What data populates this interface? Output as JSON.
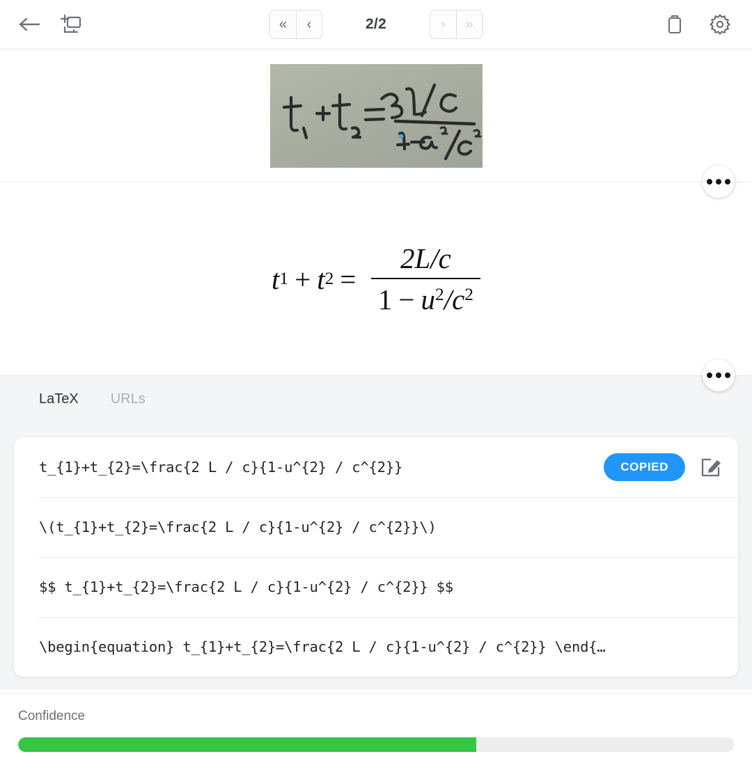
{
  "toolbar": {
    "back_icon": "back-arrow-icon",
    "snip_icon": "new-snip-screen-icon",
    "first_label": "«",
    "prev_label": "‹",
    "next_label": "›",
    "last_label": "»",
    "page_indicator": "2/2",
    "delete_icon": "trash-icon",
    "settings_icon": "gear-icon"
  },
  "source_image": {
    "alt": "handwritten equation photo",
    "handwriting": "t₁ + t₂ = 2L/c over 1 - u²/c²"
  },
  "rendered_equation": {
    "lhs_t": "t",
    "sub1": "1",
    "plus": "+",
    "sub2": "2",
    "equals": "=",
    "numerator": "2L/c",
    "den_one": "1",
    "den_minus": "−",
    "den_u": "u",
    "den_sup1": "2",
    "den_slash": "/",
    "den_c": "c",
    "den_sup2": "2"
  },
  "overflow_buttons": {
    "image_menu_label": "•••",
    "render_menu_label": "•••"
  },
  "tabs": [
    {
      "label": "LaTeX",
      "active": true
    },
    {
      "label": "URLs",
      "active": false
    }
  ],
  "latex_rows": [
    {
      "code": "t_{1}+t_{2}=\\frac{2 L / c}{1-u^{2} / c^{2}}",
      "copied_label": "COPIED",
      "edit_icon": "edit-square-icon"
    },
    {
      "code": "\\(t_{1}+t_{2}=\\frac{2 L / c}{1-u^{2} / c^{2}}\\)"
    },
    {
      "code": "$$ t_{1}+t_{2}=\\frac{2 L / c}{1-u^{2} / c^{2}} $$"
    },
    {
      "code": "\\begin{equation} t_{1}+t_{2}=\\frac{2 L / c}{1-u^{2} / c^{2}} \\end{…"
    }
  ],
  "confidence": {
    "label": "Confidence",
    "percent": 64
  },
  "colors": {
    "accent_blue": "#2196F9",
    "confidence_green": "#35C645",
    "panel_bg": "#F4F5F7",
    "icon_gray": "#6C7079"
  }
}
